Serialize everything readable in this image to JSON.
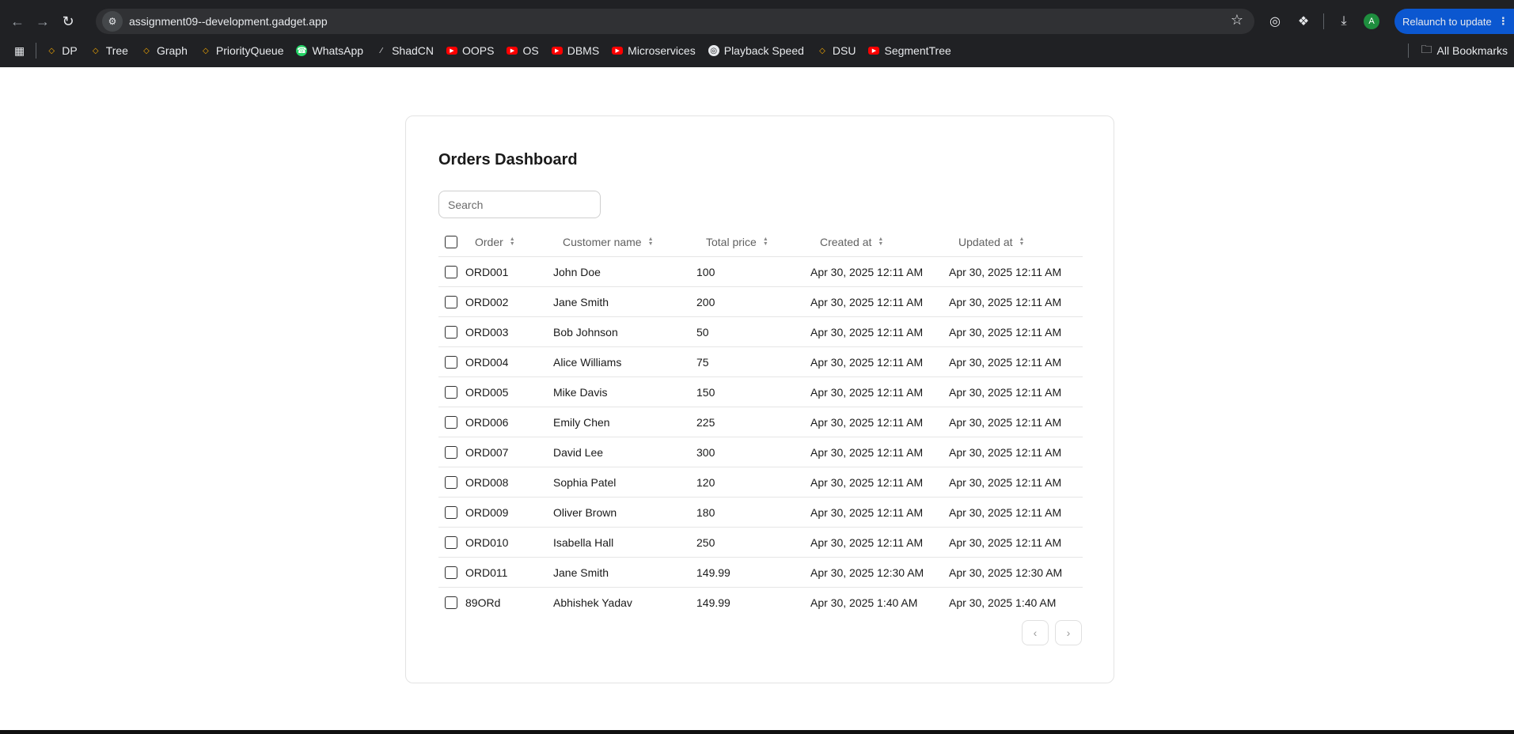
{
  "browser": {
    "url": "assignment09--development.gadget.app",
    "relaunch_label": "Relaunch to update",
    "profile_initial": "A",
    "all_bookmarks_label": "All Bookmarks",
    "bookmarks": [
      {
        "label": "DP",
        "icon": "gadget-icon"
      },
      {
        "label": "Tree",
        "icon": "gadget-icon"
      },
      {
        "label": "Graph",
        "icon": "gadget-icon"
      },
      {
        "label": "PriorityQueue",
        "icon": "gadget-icon"
      },
      {
        "label": "WhatsApp",
        "icon": "whatsapp-icon"
      },
      {
        "label": "ShadCN",
        "icon": "shadcn-icon"
      },
      {
        "label": "OOPS",
        "icon": "youtube-icon"
      },
      {
        "label": "OS",
        "icon": "youtube-icon"
      },
      {
        "label": "DBMS",
        "icon": "youtube-icon"
      },
      {
        "label": "Microservices",
        "icon": "youtube-icon"
      },
      {
        "label": "Playback Speed",
        "icon": "globe-icon"
      },
      {
        "label": "DSU",
        "icon": "gadget-icon"
      },
      {
        "label": "SegmentTree",
        "icon": "youtube-icon"
      }
    ]
  },
  "dashboard": {
    "title": "Orders Dashboard",
    "search_placeholder": "Search",
    "columns": {
      "order": "Order",
      "customer": "Customer name",
      "total": "Total price",
      "created": "Created at",
      "updated": "Updated at"
    },
    "rows": [
      {
        "order": "ORD001",
        "customer": "John Doe",
        "total": "100",
        "created": "Apr 30, 2025 12:11 AM",
        "updated": "Apr 30, 2025 12:11 AM"
      },
      {
        "order": "ORD002",
        "customer": "Jane Smith",
        "total": "200",
        "created": "Apr 30, 2025 12:11 AM",
        "updated": "Apr 30, 2025 12:11 AM"
      },
      {
        "order": "ORD003",
        "customer": "Bob Johnson",
        "total": "50",
        "created": "Apr 30, 2025 12:11 AM",
        "updated": "Apr 30, 2025 12:11 AM"
      },
      {
        "order": "ORD004",
        "customer": "Alice Williams",
        "total": "75",
        "created": "Apr 30, 2025 12:11 AM",
        "updated": "Apr 30, 2025 12:11 AM"
      },
      {
        "order": "ORD005",
        "customer": "Mike Davis",
        "total": "150",
        "created": "Apr 30, 2025 12:11 AM",
        "updated": "Apr 30, 2025 12:11 AM"
      },
      {
        "order": "ORD006",
        "customer": "Emily Chen",
        "total": "225",
        "created": "Apr 30, 2025 12:11 AM",
        "updated": "Apr 30, 2025 12:11 AM"
      },
      {
        "order": "ORD007",
        "customer": "David Lee",
        "total": "300",
        "created": "Apr 30, 2025 12:11 AM",
        "updated": "Apr 30, 2025 12:11 AM"
      },
      {
        "order": "ORD008",
        "customer": "Sophia Patel",
        "total": "120",
        "created": "Apr 30, 2025 12:11 AM",
        "updated": "Apr 30, 2025 12:11 AM"
      },
      {
        "order": "ORD009",
        "customer": "Oliver Brown",
        "total": "180",
        "created": "Apr 30, 2025 12:11 AM",
        "updated": "Apr 30, 2025 12:11 AM"
      },
      {
        "order": "ORD010",
        "customer": "Isabella Hall",
        "total": "250",
        "created": "Apr 30, 2025 12:11 AM",
        "updated": "Apr 30, 2025 12:11 AM"
      },
      {
        "order": "ORD011",
        "customer": "Jane Smith",
        "total": "149.99",
        "created": "Apr 30, 2025 12:30 AM",
        "updated": "Apr 30, 2025 12:30 AM"
      },
      {
        "order": "89ORd",
        "customer": "Abhishek Yadav",
        "total": "149.99",
        "created": "Apr 30, 2025 1:40 AM",
        "updated": "Apr 30, 2025 1:40 AM"
      }
    ]
  },
  "colors": {
    "browser_bg": "#202124",
    "relaunch_bg": "#0b57d0",
    "page_bg": "#ffffff"
  }
}
